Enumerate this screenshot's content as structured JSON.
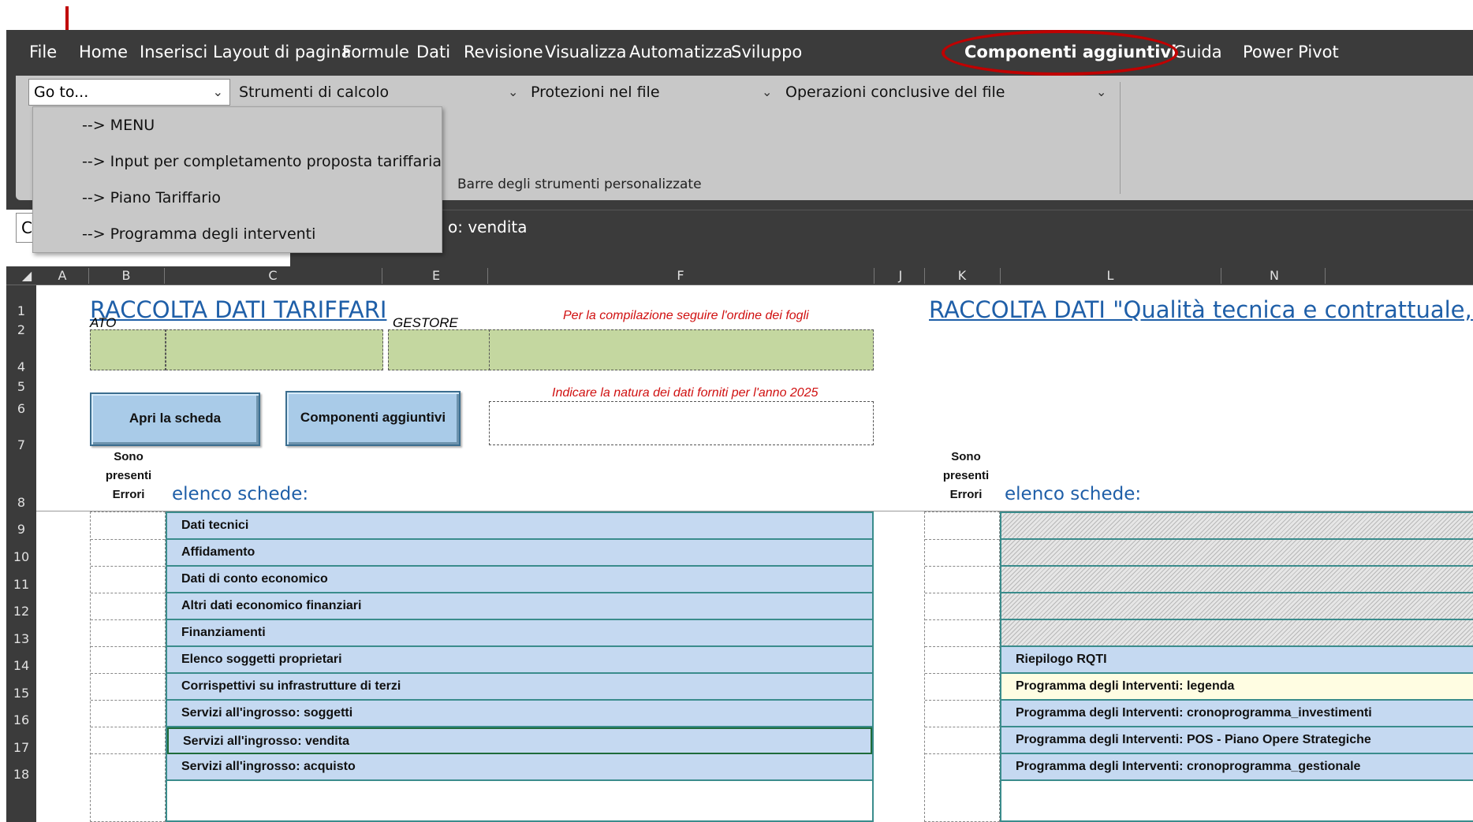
{
  "menu": {
    "tabs": [
      "File",
      "Home",
      "Inserisci",
      "Layout di pagina",
      "Formule",
      "Dati",
      "Revisione",
      "Visualizza",
      "Automatizza",
      "Sviluppo",
      "Componenti aggiuntivi",
      "Guida",
      "Power Pivot"
    ],
    "active_tab": "Componenti aggiuntivi"
  },
  "ribbon": {
    "goto_value": "Go to...",
    "combo_strumenti": "Strumenti di calcolo",
    "combo_protezioni": "Protezioni nel file",
    "combo_operazioni": "Operazioni conclusive del file",
    "group_label": "Barre degli strumenti personalizzate",
    "dropdown_items": [
      "--> MENU",
      "--> Input per completamento proposta tariffaria",
      "--> Piano Tariffario",
      "--> Programma degli interventi"
    ]
  },
  "formula_bar": {
    "name_box": "C",
    "content": "o: vendita"
  },
  "columns": [
    "A",
    "B",
    "C",
    "E",
    "F",
    "J",
    "K",
    "L",
    "N"
  ],
  "rows": [
    "1",
    "2",
    "4",
    "5",
    "6",
    "7",
    "8",
    "9",
    "10",
    "11",
    "12",
    "13",
    "14",
    "15",
    "16",
    "17",
    "18"
  ],
  "sheet": {
    "title_left": "RACCOLTA DATI TARIFFARI",
    "title_right": "RACCOLTA DATI \"Qualità tecnica e contrattuale, Pd",
    "note_order": "Per la compilazione seguire l'ordine dei fogli",
    "label_ato": "ATO",
    "label_gestore": "GESTORE",
    "note_natura": "Indicare la natura dei dati forniti per l'anno 2025",
    "btn_apri": "Apri la scheda",
    "btn_componenti": "Componenti aggiuntivi",
    "errori_header_1": "Sono",
    "errori_header_2": "presenti",
    "errori_header_3": "Errori",
    "elenco_label": "elenco schede:",
    "left_list": [
      "Dati tecnici",
      "Affidamento",
      "Dati di conto economico",
      "Altri dati economico finanziari",
      "Finanziamenti",
      "Elenco soggetti proprietari",
      "Corrispettivi su infrastrutture di terzi",
      "Servizi all'ingrosso: soggetti",
      "Servizi all'ingrosso: vendita",
      "Servizi all'ingrosso: acquisto"
    ],
    "right_list": [
      "",
      "",
      "",
      "",
      "",
      "Riepilogo RQTI",
      "Programma degli Interventi: legenda",
      "Programma degli Interventi: cronoprogramma_investimenti",
      "Programma degli Interventi: POS - Piano Opere Strategiche",
      "Programma degli Interventi: cronoprogramma_gestionale"
    ]
  },
  "colors": {
    "ribbon_dark": "#3b3b3b",
    "ribbon_light": "#c8c8c8",
    "highlight_red": "#c00000",
    "title_blue": "#1f5fa8",
    "input_green": "#c4d7a0",
    "list_blue": "#c5d9f1",
    "list_yellow": "#fffde2"
  }
}
